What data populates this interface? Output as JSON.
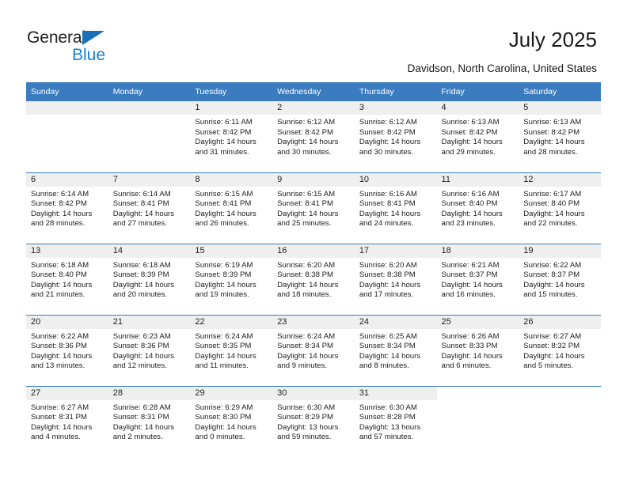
{
  "brand": {
    "name_dark": "General",
    "name_blue": "Blue",
    "accent_blue": "#1a7fd4",
    "triangle_blue": "#1a6fb5"
  },
  "header": {
    "title": "July 2025",
    "subtitle": "Davidson, North Carolina, United States",
    "header_bg": "#3b7cc0",
    "daynum_bg": "#efefef"
  },
  "weekdays": [
    "Sunday",
    "Monday",
    "Tuesday",
    "Wednesday",
    "Thursday",
    "Friday",
    "Saturday"
  ],
  "weeks": [
    [
      {
        "day": "",
        "lines": []
      },
      {
        "day": "",
        "lines": []
      },
      {
        "day": "1",
        "lines": [
          "Sunrise: 6:11 AM",
          "Sunset: 8:42 PM",
          "Daylight: 14 hours",
          "and 31 minutes."
        ]
      },
      {
        "day": "2",
        "lines": [
          "Sunrise: 6:12 AM",
          "Sunset: 8:42 PM",
          "Daylight: 14 hours",
          "and 30 minutes."
        ]
      },
      {
        "day": "3",
        "lines": [
          "Sunrise: 6:12 AM",
          "Sunset: 8:42 PM",
          "Daylight: 14 hours",
          "and 30 minutes."
        ]
      },
      {
        "day": "4",
        "lines": [
          "Sunrise: 6:13 AM",
          "Sunset: 8:42 PM",
          "Daylight: 14 hours",
          "and 29 minutes."
        ]
      },
      {
        "day": "5",
        "lines": [
          "Sunrise: 6:13 AM",
          "Sunset: 8:42 PM",
          "Daylight: 14 hours",
          "and 28 minutes."
        ]
      }
    ],
    [
      {
        "day": "6",
        "lines": [
          "Sunrise: 6:14 AM",
          "Sunset: 8:42 PM",
          "Daylight: 14 hours",
          "and 28 minutes."
        ]
      },
      {
        "day": "7",
        "lines": [
          "Sunrise: 6:14 AM",
          "Sunset: 8:41 PM",
          "Daylight: 14 hours",
          "and 27 minutes."
        ]
      },
      {
        "day": "8",
        "lines": [
          "Sunrise: 6:15 AM",
          "Sunset: 8:41 PM",
          "Daylight: 14 hours",
          "and 26 minutes."
        ]
      },
      {
        "day": "9",
        "lines": [
          "Sunrise: 6:15 AM",
          "Sunset: 8:41 PM",
          "Daylight: 14 hours",
          "and 25 minutes."
        ]
      },
      {
        "day": "10",
        "lines": [
          "Sunrise: 6:16 AM",
          "Sunset: 8:41 PM",
          "Daylight: 14 hours",
          "and 24 minutes."
        ]
      },
      {
        "day": "11",
        "lines": [
          "Sunrise: 6:16 AM",
          "Sunset: 8:40 PM",
          "Daylight: 14 hours",
          "and 23 minutes."
        ]
      },
      {
        "day": "12",
        "lines": [
          "Sunrise: 6:17 AM",
          "Sunset: 8:40 PM",
          "Daylight: 14 hours",
          "and 22 minutes."
        ]
      }
    ],
    [
      {
        "day": "13",
        "lines": [
          "Sunrise: 6:18 AM",
          "Sunset: 8:40 PM",
          "Daylight: 14 hours",
          "and 21 minutes."
        ]
      },
      {
        "day": "14",
        "lines": [
          "Sunrise: 6:18 AM",
          "Sunset: 8:39 PM",
          "Daylight: 14 hours",
          "and 20 minutes."
        ]
      },
      {
        "day": "15",
        "lines": [
          "Sunrise: 6:19 AM",
          "Sunset: 8:39 PM",
          "Daylight: 14 hours",
          "and 19 minutes."
        ]
      },
      {
        "day": "16",
        "lines": [
          "Sunrise: 6:20 AM",
          "Sunset: 8:38 PM",
          "Daylight: 14 hours",
          "and 18 minutes."
        ]
      },
      {
        "day": "17",
        "lines": [
          "Sunrise: 6:20 AM",
          "Sunset: 8:38 PM",
          "Daylight: 14 hours",
          "and 17 minutes."
        ]
      },
      {
        "day": "18",
        "lines": [
          "Sunrise: 6:21 AM",
          "Sunset: 8:37 PM",
          "Daylight: 14 hours",
          "and 16 minutes."
        ]
      },
      {
        "day": "19",
        "lines": [
          "Sunrise: 6:22 AM",
          "Sunset: 8:37 PM",
          "Daylight: 14 hours",
          "and 15 minutes."
        ]
      }
    ],
    [
      {
        "day": "20",
        "lines": [
          "Sunrise: 6:22 AM",
          "Sunset: 8:36 PM",
          "Daylight: 14 hours",
          "and 13 minutes."
        ]
      },
      {
        "day": "21",
        "lines": [
          "Sunrise: 6:23 AM",
          "Sunset: 8:36 PM",
          "Daylight: 14 hours",
          "and 12 minutes."
        ]
      },
      {
        "day": "22",
        "lines": [
          "Sunrise: 6:24 AM",
          "Sunset: 8:35 PM",
          "Daylight: 14 hours",
          "and 11 minutes."
        ]
      },
      {
        "day": "23",
        "lines": [
          "Sunrise: 6:24 AM",
          "Sunset: 8:34 PM",
          "Daylight: 14 hours",
          "and 9 minutes."
        ]
      },
      {
        "day": "24",
        "lines": [
          "Sunrise: 6:25 AM",
          "Sunset: 8:34 PM",
          "Daylight: 14 hours",
          "and 8 minutes."
        ]
      },
      {
        "day": "25",
        "lines": [
          "Sunrise: 6:26 AM",
          "Sunset: 8:33 PM",
          "Daylight: 14 hours",
          "and 6 minutes."
        ]
      },
      {
        "day": "26",
        "lines": [
          "Sunrise: 6:27 AM",
          "Sunset: 8:32 PM",
          "Daylight: 14 hours",
          "and 5 minutes."
        ]
      }
    ],
    [
      {
        "day": "27",
        "lines": [
          "Sunrise: 6:27 AM",
          "Sunset: 8:31 PM",
          "Daylight: 14 hours",
          "and 4 minutes."
        ]
      },
      {
        "day": "28",
        "lines": [
          "Sunrise: 6:28 AM",
          "Sunset: 8:31 PM",
          "Daylight: 14 hours",
          "and 2 minutes."
        ]
      },
      {
        "day": "29",
        "lines": [
          "Sunrise: 6:29 AM",
          "Sunset: 8:30 PM",
          "Daylight: 14 hours",
          "and 0 minutes."
        ]
      },
      {
        "day": "30",
        "lines": [
          "Sunrise: 6:30 AM",
          "Sunset: 8:29 PM",
          "Daylight: 13 hours",
          "and 59 minutes."
        ]
      },
      {
        "day": "31",
        "lines": [
          "Sunrise: 6:30 AM",
          "Sunset: 8:28 PM",
          "Daylight: 13 hours",
          "and 57 minutes."
        ]
      },
      {
        "day": "",
        "lines": []
      },
      {
        "day": "",
        "lines": []
      }
    ]
  ]
}
